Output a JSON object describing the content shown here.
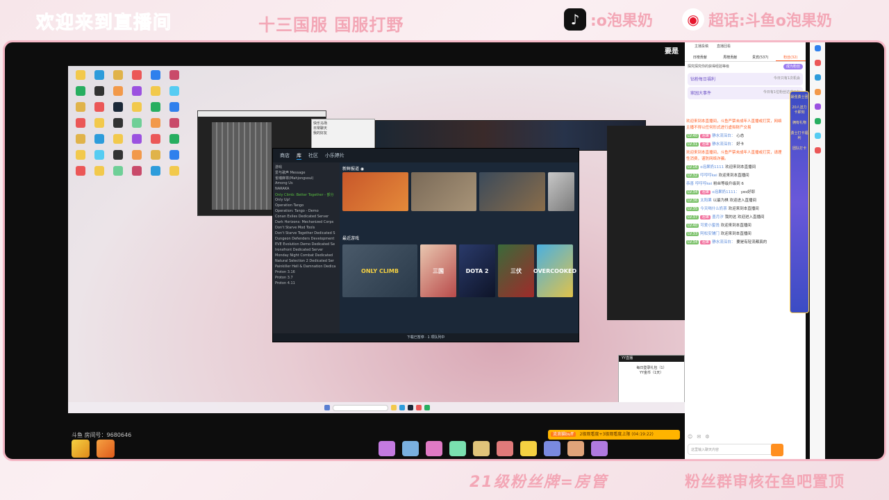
{
  "overlay": {
    "title": "欢迎来到直播间",
    "subtitle": "十三国服 国服打野",
    "douyin_handle": ":o泡果奶",
    "weibo_handle": "超话:斗鱼o泡果奶",
    "bottom_left": "21级粉丝牌=房管",
    "bottom_right": "粉丝群审核在鱼吧置顶"
  },
  "stream": {
    "room_number": "斗鱼 房间号：9680646",
    "marquee": "要是"
  },
  "steam": {
    "nav": [
      "商店",
      "库",
      "社区",
      "小乐婷片"
    ],
    "nav_active_index": 1,
    "section_news": "新鲜报道 ◉",
    "section_recent": "最近游戏",
    "library": [
      "游戏",
      "爱与歌声 Message",
      "雀魂麻将(Mahjongsoul)",
      "Among Us",
      "NARAKA",
      "Only Climb: Better Together - 部分",
      "Only Up!",
      "Operation Tango",
      "Operation: Tango - Demo",
      "Conan Exiles Dedicated Server",
      "Dark Horizons: Mechanized Corps",
      "Don't Starve Mod Tools",
      "Don't Starve Together Dedicated S",
      "Dungeon Defenders Development",
      "EVE Evolution Demo Dedicated Se",
      "Ironsfront Dedicated Server",
      "Monday Night Combat Dedicated",
      "Natural Selection 2 Dedicated Ser",
      "Painkiller Hell & Damnation Dedica",
      "Proton 3.16",
      "Proton 3.7",
      "Proton 4.11"
    ],
    "games": [
      "ONLY CLIMB",
      "三国",
      "DOTA 2",
      "三伏",
      "OVERCOOKED"
    ],
    "status": "下载已暂停 · 1 项队列中"
  },
  "qq_window": {
    "title": "快乐马场",
    "lines": [
      "日常聊天",
      "我的好友"
    ]
  },
  "popup": {
    "header": "YY直播",
    "title": "每日登录礼包（1）",
    "body": "YY金币（1天）"
  },
  "notice": {
    "tag": "流浪猫buff",
    "text": "2级观看度+3级观看度上限 (04:19:22)"
  },
  "sidebar": {
    "top_links": [
      "主播投稿",
      "直播回看"
    ],
    "tabs": [
      "日榜贡献",
      "周榜贡献",
      "贵宾(537)",
      "粉丝(32)"
    ],
    "active_tab_index": 3,
    "tip": "探究探究你的获得经验等级",
    "tip_button": "成为粉丝",
    "notice1": "钻粉每日福利",
    "notice1_right": "今日只有1次机会",
    "notice2": "家园大事件",
    "notice2_right": "今日有1位粉丝达成目标",
    "input_placeholder": "这里输入聊天内容",
    "messages": [
      {
        "type": "sys",
        "text": "欢迎来到本直播间，斗鱼严禁未成年人直播或打赏，网络主播不得以任何形式进行虚拟财产交易"
      },
      {
        "type": "chat",
        "lv": "LV.40",
        "badge": "泡果",
        "nick": "静水流深白：",
        "text": "心态"
      },
      {
        "type": "chat",
        "lv": "LV.31",
        "badge": "泡果",
        "nick": "静水流深白：",
        "text": "好卡"
      },
      {
        "type": "sys",
        "text": "欢迎来到本直播间，斗鱼严禁未成年人直播或打赏，请理性消费，谨防网络诈骗。"
      },
      {
        "type": "chat",
        "lv": "LV.16",
        "badge": "",
        "nick": "o泡果奶1111",
        "text": "欢迎来到本直播间"
      },
      {
        "type": "chat",
        "lv": "LV.32",
        "badge": "",
        "nick": "哼哼哼kei",
        "text": "欢迎来到本直播间"
      },
      {
        "type": "chat",
        "lv": "",
        "badge": "",
        "nick": "恭喜 哼哼哼kei",
        "text": "粉丝等级升级到 6"
      },
      {
        "type": "chat",
        "lv": "LV.34",
        "badge": "泡果",
        "nick": "o泡果奶1111：",
        "text": "yes好耶"
      },
      {
        "type": "chat",
        "lv": "LV.36",
        "badge": "",
        "nick": "太阳果",
        "text": "以最为棋 欢迎进入直播间"
      },
      {
        "type": "chat",
        "lv": "LV.35",
        "badge": "",
        "nick": "今天喝什么奶茶",
        "text": "欢迎来到本直播间"
      },
      {
        "type": "chat",
        "lv": "LV.37",
        "badge": "泡果",
        "nick": "墨月汐",
        "text": "我的这 欢迎进入直播间"
      },
      {
        "type": "chat",
        "lv": "LV.40",
        "badge": "",
        "nick": "可爱小蜜饯",
        "text": "欢迎来到本直播间"
      },
      {
        "type": "chat",
        "lv": "LV.33",
        "badge": "",
        "nick": "阿松安铺门",
        "text": "欢迎来到本直播间"
      },
      {
        "type": "chat",
        "lv": "LV.34",
        "badge": "泡果",
        "nick": "静水流深白：",
        "text": "要是有轻流都真的"
      }
    ]
  },
  "float_panel": {
    "title": "最强勇士团",
    "line1": "20人送力卡即刻",
    "line2": "拥有礼物",
    "line3": "勇士打卡福利",
    "line4": "团队打卡"
  },
  "colors": {
    "accent_pink": "#f3a7b6",
    "frame_border": "#f5b8c6",
    "douyu_orange": "#ff5d23",
    "steam_bg": "#1b2838"
  }
}
